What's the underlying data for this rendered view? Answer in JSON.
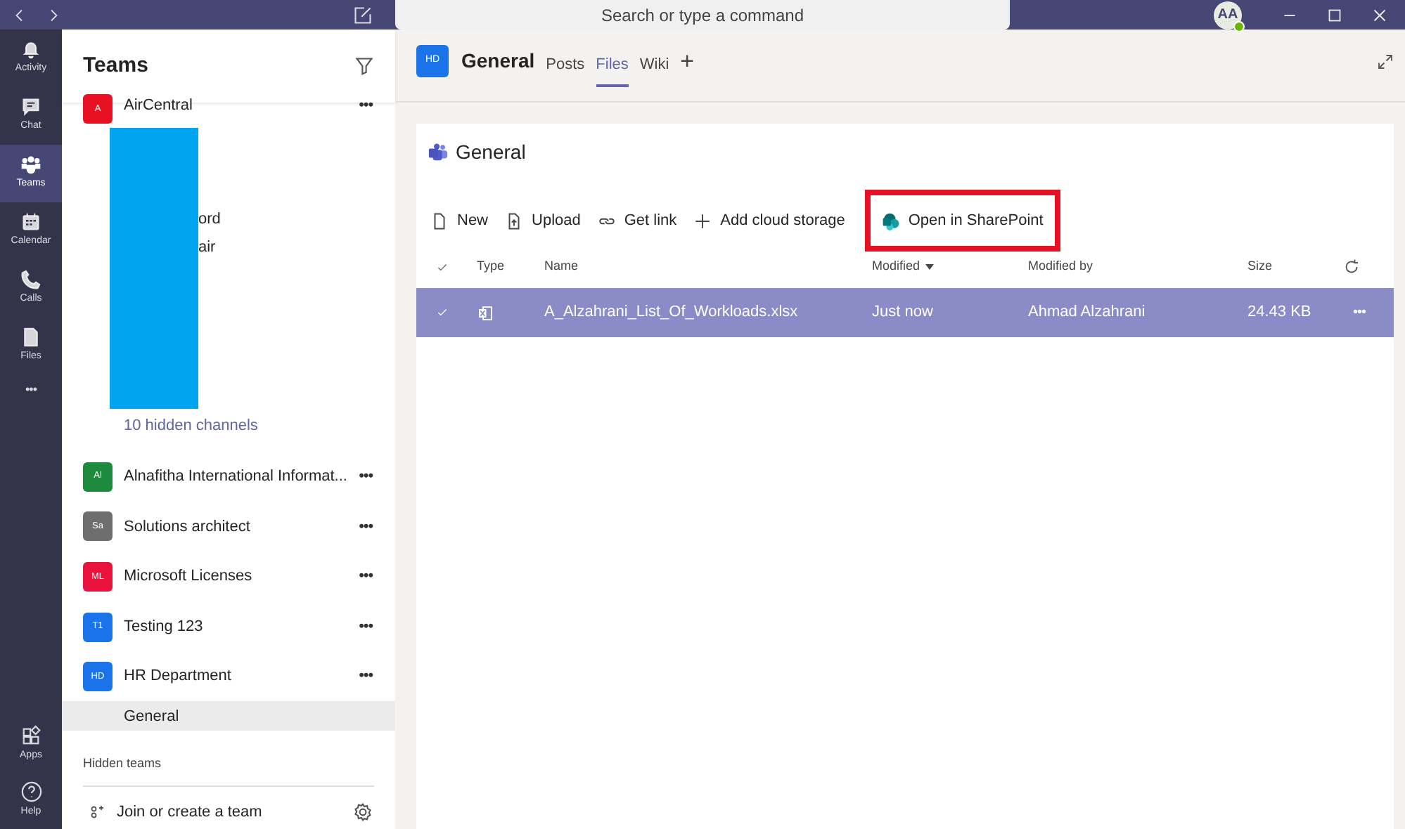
{
  "titlebar": {
    "search_placeholder": "Search or type a command",
    "avatar": "AA"
  },
  "rail": {
    "items": [
      {
        "label": "Activity",
        "selected": false
      },
      {
        "label": "Chat",
        "selected": false
      },
      {
        "label": "Teams",
        "selected": true
      },
      {
        "label": "Calendar",
        "selected": false
      },
      {
        "label": "Calls",
        "selected": false
      },
      {
        "label": "Files",
        "selected": false
      }
    ],
    "more": "•••",
    "bottom": [
      {
        "label": "Apps"
      },
      {
        "label": "Help"
      }
    ]
  },
  "sidebar": {
    "title": "Teams",
    "teams": [
      {
        "kind": "redacted",
        "initials": "A",
        "name": "AirCentral",
        "color": "#e81123",
        "more": "•••",
        "channels": [
          {
            "name": "ord"
          },
          {
            "name": "air"
          }
        ],
        "hidden_channels": "10 hidden channels"
      },
      {
        "kind": "team",
        "initials": "Al",
        "name": "Alnafitha International Informat...",
        "color": "#1e8a3e",
        "more": "•••"
      },
      {
        "kind": "team",
        "initials": "Sa",
        "name": "Solutions architect",
        "color": "#6e6e6e",
        "more": "•••"
      },
      {
        "kind": "team",
        "initials": "ML",
        "name": "Microsoft Licenses",
        "color": "#e8123c",
        "more": "•••"
      },
      {
        "kind": "team",
        "initials": "T1",
        "name": "Testing 123",
        "color": "#1a73e8",
        "more": "•••"
      },
      {
        "kind": "team",
        "initials": "HD",
        "name": "HR Department",
        "color": "#1a73e8",
        "more": "•••",
        "channels": [
          {
            "name": "General",
            "selected": true
          }
        ]
      }
    ],
    "hidden_teams": "Hidden teams",
    "join": "Join or create a team"
  },
  "header": {
    "initials": "HD",
    "channel": "General",
    "tabs": [
      {
        "label": "Posts",
        "selected": false
      },
      {
        "label": "Files",
        "selected": true
      },
      {
        "label": "Wiki",
        "selected": false
      }
    ],
    "add": "+"
  },
  "files": {
    "title": "General",
    "toolbar": [
      {
        "label": "New",
        "highlighted": false
      },
      {
        "label": "Upload",
        "highlighted": false
      },
      {
        "label": "Get link",
        "highlighted": false
      },
      {
        "label": "Add cloud storage",
        "highlighted": false
      },
      {
        "label": "Open in SharePoint",
        "highlighted": true
      }
    ],
    "columns": [
      "Type",
      "Name",
      "Modified",
      "Modified by",
      "Size"
    ],
    "rows": [
      {
        "name": "A_Alzahrani_List_Of_Workloads.xlsx",
        "modified": "Just now",
        "modified_by": "Ahmad Alzahrani",
        "size": "24.43 KB",
        "more": "•••",
        "selected": true
      }
    ]
  }
}
